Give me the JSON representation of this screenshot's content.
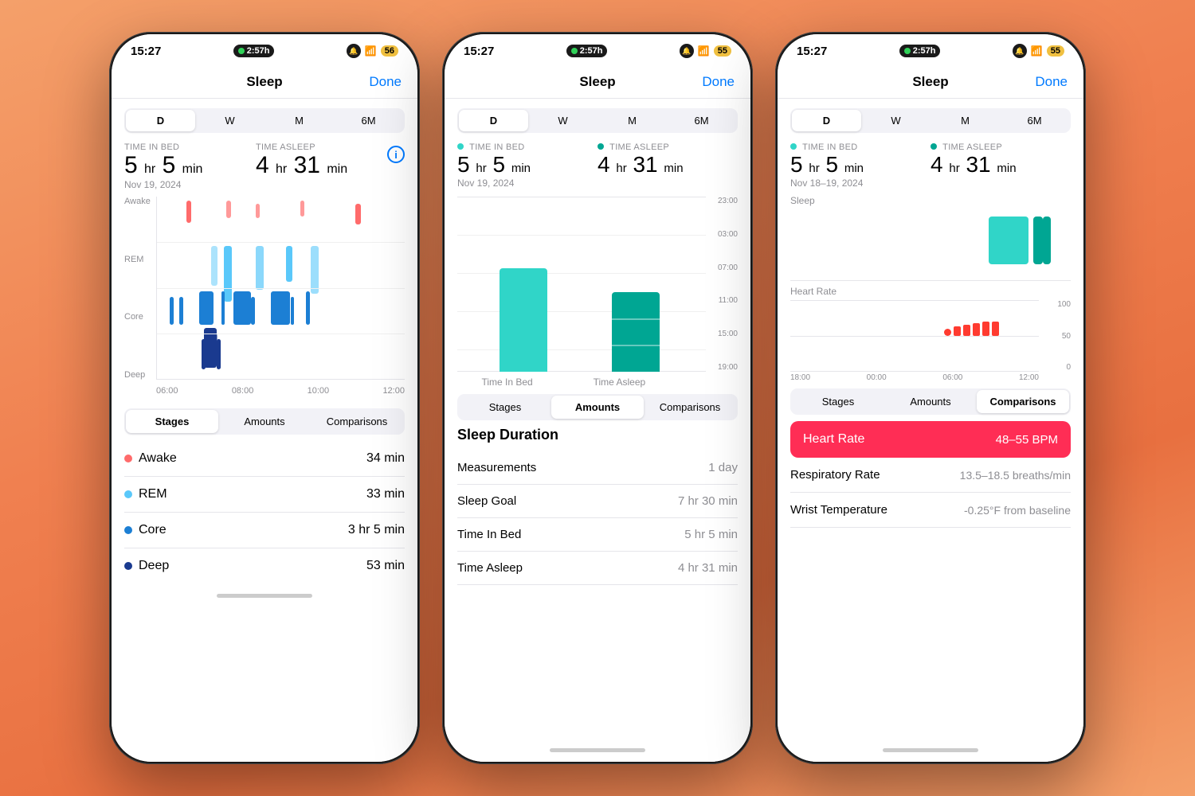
{
  "statusBar": {
    "time": "15:27",
    "timer": "2:57h",
    "battery": "56",
    "battery2": "55"
  },
  "phone1": {
    "title": "Sleep",
    "done": "Done",
    "tabs": [
      "D",
      "W",
      "M",
      "6M"
    ],
    "activeTab": "D",
    "timeInBedLabel": "TIME IN BED",
    "timeAsleepLabel": "TIME ASLEEP",
    "timeInBed": "5 hr 5 min",
    "timeAsleep": "4 hr 31 min",
    "date": "Nov 19, 2024",
    "chartLabels": [
      "Awake",
      "REM",
      "Core",
      "Deep"
    ],
    "timeLabels": [
      "06:00",
      "08:00",
      "10:00",
      "12:00"
    ],
    "bottomTabs": [
      "Stages",
      "Amounts",
      "Comparisons"
    ],
    "activeBottomTab": "Stages",
    "stages": [
      {
        "label": "Awake",
        "color": "#ff6b6b",
        "value": "34 min"
      },
      {
        "label": "REM",
        "color": "#5ac8fa",
        "value": "33 min"
      },
      {
        "label": "Core",
        "color": "#1c7fd4",
        "value": "3 hr 5 min"
      },
      {
        "label": "Deep",
        "color": "#1a3a8f",
        "value": "53 min"
      }
    ]
  },
  "phone2": {
    "title": "Sleep",
    "done": "Done",
    "tabs": [
      "D",
      "W",
      "M",
      "6M"
    ],
    "activeTab": "D",
    "timeInBedLabel": "TIME IN BED",
    "timeAsleepLabel": "TIME ASLEEP",
    "timeInBed": "5 hr 5 min",
    "timeAsleep": "4 hr 31 min",
    "date": "Nov 19, 2024",
    "timeAxisLabels": [
      "23:00",
      "03:00",
      "07:00",
      "11:00",
      "15:00",
      "19:00"
    ],
    "bar1Label": "Time In Bed",
    "bar2Label": "Time Asleep",
    "bottomTabs": [
      "Stages",
      "Amounts",
      "Comparisons"
    ],
    "activeBottomTab": "Amounts",
    "sectionTitle": "Sleep Duration",
    "dataRows": [
      {
        "label": "Measurements",
        "value": "1 day"
      },
      {
        "label": "Sleep Goal",
        "value": "7 hr 30 min"
      },
      {
        "label": "Time In Bed",
        "value": "5 hr 5 min"
      },
      {
        "label": "Time Asleep",
        "value": "4 hr 31 min"
      }
    ]
  },
  "phone3": {
    "title": "Sleep",
    "done": "Done",
    "tabs": [
      "D",
      "W",
      "M",
      "6M"
    ],
    "activeTab": "D",
    "timeInBedLabel": "TIME IN BED",
    "timeAsleepLabel": "TIME ASLEEP",
    "timeInBed": "5 hr 5 min",
    "timeAsleep": "4 hr 31 min",
    "date": "Nov 18–19, 2024",
    "sleepLabel": "Sleep",
    "heartRateLabel": "Heart Rate",
    "heartYLabels": [
      "100",
      "50",
      "0"
    ],
    "heartXLabels": [
      "18:00",
      "00:00",
      "06:00",
      "12:00"
    ],
    "bottomTabs": [
      "Stages",
      "Amounts",
      "Comparisons"
    ],
    "activeBottomTab": "Comparisons",
    "highlightRow": {
      "label": "Heart Rate",
      "value": "48–55 BPM",
      "color": "#ff2d55"
    },
    "compRows": [
      {
        "label": "Respiratory Rate",
        "value": "13.5–18.5 breaths/min"
      },
      {
        "label": "Wrist Temperature",
        "value": "-0.25°F from baseline"
      }
    ]
  }
}
